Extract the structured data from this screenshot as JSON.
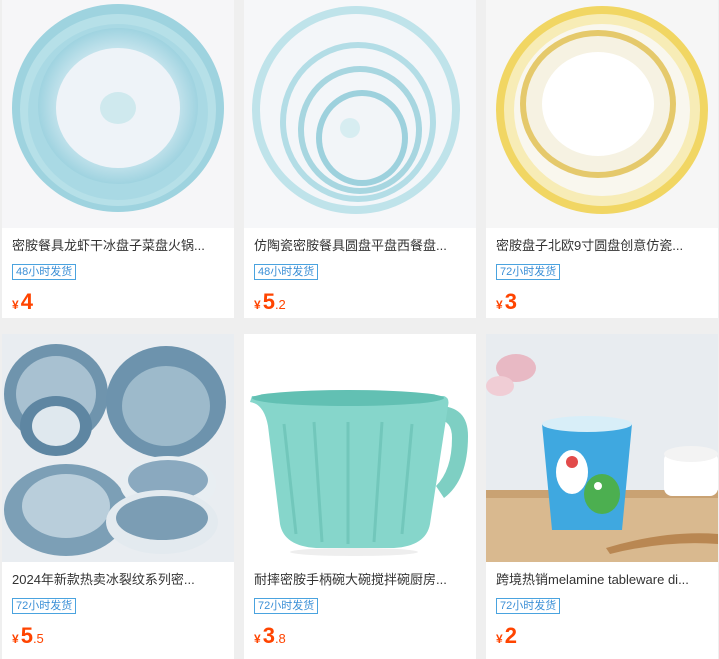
{
  "products": [
    {
      "title": "密胺餐具龙虾干冰盘子菜盘火锅...",
      "badge": "48小时发货",
      "currency": "¥",
      "price_int": "4",
      "price_dec": "",
      "image": "turquoise-scalloped-plate-stack"
    },
    {
      "title": "仿陶瓷密胺餐具圆盘平盘西餐盘...",
      "badge": "48小时发货",
      "currency": "¥",
      "price_int": "5",
      "price_dec": ".2",
      "image": "turquoise-round-plate-set"
    },
    {
      "title": "密胺盘子北欧9寸圆盘创意仿瓷...",
      "badge": "72小时发货",
      "currency": "¥",
      "price_int": "3",
      "price_dec": "",
      "image": "gold-rim-plate-stack"
    },
    {
      "title": "2024年新款热卖冰裂纹系列密...",
      "badge": "72小时发货",
      "currency": "¥",
      "price_int": "5",
      "price_dec": ".5",
      "image": "blue-crackle-dinnerware-set"
    },
    {
      "title": "耐摔密胺手柄碗大碗搅拌碗厨房...",
      "badge": "72小时发货",
      "currency": "¥",
      "price_int": "3",
      "price_dec": ".8",
      "image": "mint-mixing-bowl-with-handle"
    },
    {
      "title": "跨境热销melamine tableware di...",
      "badge": "72小时发货",
      "currency": "¥",
      "price_int": "2",
      "price_dec": "",
      "image": "cartoon-kids-cup"
    }
  ],
  "colors": {
    "price": "#ff4400",
    "badge_border": "#4aa3df",
    "badge_text": "#3b8fd6",
    "background": "#efefef"
  }
}
